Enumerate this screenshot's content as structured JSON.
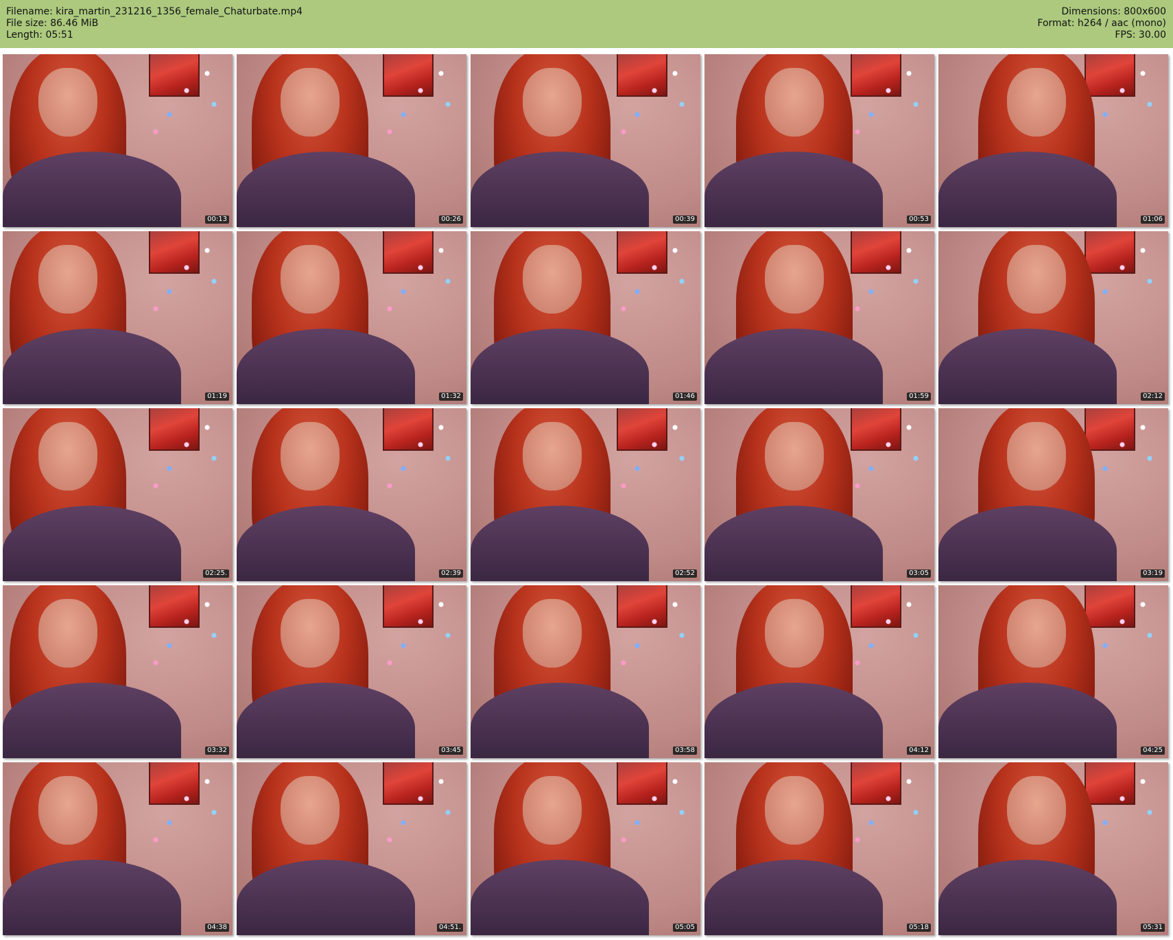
{
  "header": {
    "filename": "Filename: kira_martin_231216_1356_female_Chaturbate.mp4",
    "filesize": "File size: 86.46 MiB",
    "length": "Length: 05:51",
    "dimensions": "Dimensions: 800x600",
    "format": "Format: h264 / aac (mono)",
    "fps": "FPS: 30.00"
  },
  "colors": {
    "header_bg": "#acc97e",
    "timestamp_bg": "#1e1e1e"
  },
  "thumbnails": [
    {
      "timestamp": "00:13"
    },
    {
      "timestamp": "00:26"
    },
    {
      "timestamp": "00:39"
    },
    {
      "timestamp": "00:53"
    },
    {
      "timestamp": "01:06"
    },
    {
      "timestamp": "01:19"
    },
    {
      "timestamp": "01:32"
    },
    {
      "timestamp": "01:46"
    },
    {
      "timestamp": "01:59"
    },
    {
      "timestamp": "02:12"
    },
    {
      "timestamp": "02:25."
    },
    {
      "timestamp": "02:39"
    },
    {
      "timestamp": "02:52"
    },
    {
      "timestamp": "03:05"
    },
    {
      "timestamp": "03:19"
    },
    {
      "timestamp": "03:32"
    },
    {
      "timestamp": "03:45"
    },
    {
      "timestamp": "03:58"
    },
    {
      "timestamp": "04:12"
    },
    {
      "timestamp": "04:25"
    },
    {
      "timestamp": "04:38"
    },
    {
      "timestamp": "04:51."
    },
    {
      "timestamp": "05:05"
    },
    {
      "timestamp": "05:18"
    },
    {
      "timestamp": "05:31"
    }
  ]
}
